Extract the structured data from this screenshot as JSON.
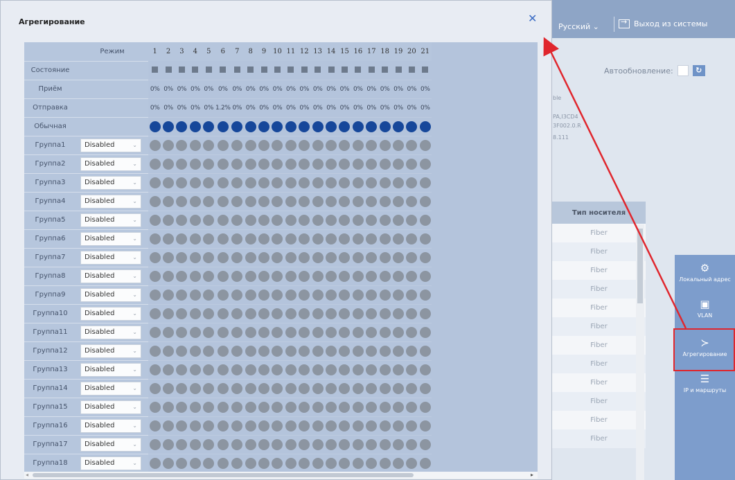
{
  "background": {
    "language": "Русский",
    "logout": "Выход из системы",
    "auto_refresh_label": "Автообновление:",
    "info_lines": [
      "ble",
      "PA,I3CD4",
      "3F002.0.R",
      "8.111"
    ],
    "table_header": "Тип носителя",
    "table_rows": [
      "Fiber",
      "Fiber",
      "Fiber",
      "Fiber",
      "Fiber",
      "Fiber",
      "Fiber",
      "Fiber",
      "Fiber",
      "Fiber",
      "Fiber",
      "Fiber"
    ],
    "side_menu": [
      {
        "label": "Локальный адрес",
        "icon": "gear-icon"
      },
      {
        "label": "VLAN",
        "icon": "vlan-icon"
      },
      {
        "label": "Агрегирование",
        "icon": "aggregation-icon"
      },
      {
        "label": "IP и маршруты",
        "icon": "route-icon"
      }
    ]
  },
  "dialog": {
    "title": "Агрегирование",
    "mode_header": "Режим",
    "ports": [
      "1",
      "2",
      "3",
      "4",
      "5",
      "6",
      "7",
      "8",
      "9",
      "10",
      "11",
      "12",
      "13",
      "14",
      "15",
      "16",
      "17",
      "18",
      "19",
      "20",
      "21"
    ],
    "row_state": "Состояние",
    "row_rx": "Приём",
    "row_tx": "Отправка",
    "row_normal": "Обычная",
    "rx_values": [
      "0%",
      "0%",
      "0%",
      "0%",
      "0%",
      "0%",
      "0%",
      "0%",
      "0%",
      "0%",
      "0%",
      "0%",
      "0%",
      "0%",
      "0%",
      "0%",
      "0%",
      "0%",
      "0%",
      "0%",
      "0%"
    ],
    "tx_values": [
      "0%",
      "0%",
      "0%",
      "0%",
      "0%",
      "1.2%",
      "0%",
      "0%",
      "0%",
      "0%",
      "0%",
      "0%",
      "0%",
      "0%",
      "0%",
      "0%",
      "0%",
      "0%",
      "0%",
      "0%",
      "0%"
    ],
    "groups": [
      {
        "name": "Группа1",
        "mode": "Disabled"
      },
      {
        "name": "Группа2",
        "mode": "Disabled"
      },
      {
        "name": "Группа3",
        "mode": "Disabled"
      },
      {
        "name": "Группа4",
        "mode": "Disabled"
      },
      {
        "name": "Группа5",
        "mode": "Disabled"
      },
      {
        "name": "Группа6",
        "mode": "Disabled"
      },
      {
        "name": "Группа7",
        "mode": "Disabled"
      },
      {
        "name": "Группа8",
        "mode": "Disabled"
      },
      {
        "name": "Группа9",
        "mode": "Disabled"
      },
      {
        "name": "Группа10",
        "mode": "Disabled"
      },
      {
        "name": "Группа11",
        "mode": "Disabled"
      },
      {
        "name": "Группа12",
        "mode": "Disabled"
      },
      {
        "name": "Группа13",
        "mode": "Disabled"
      },
      {
        "name": "Группа14",
        "mode": "Disabled"
      },
      {
        "name": "Группа15",
        "mode": "Disabled"
      },
      {
        "name": "Группа16",
        "mode": "Disabled"
      },
      {
        "name": "Группа17",
        "mode": "Disabled"
      },
      {
        "name": "Группа18",
        "mode": "Disabled"
      }
    ]
  },
  "colors": {
    "accent": "#16479a",
    "highlight": "#e0262d",
    "inactive_dot": "#8c95a1"
  }
}
